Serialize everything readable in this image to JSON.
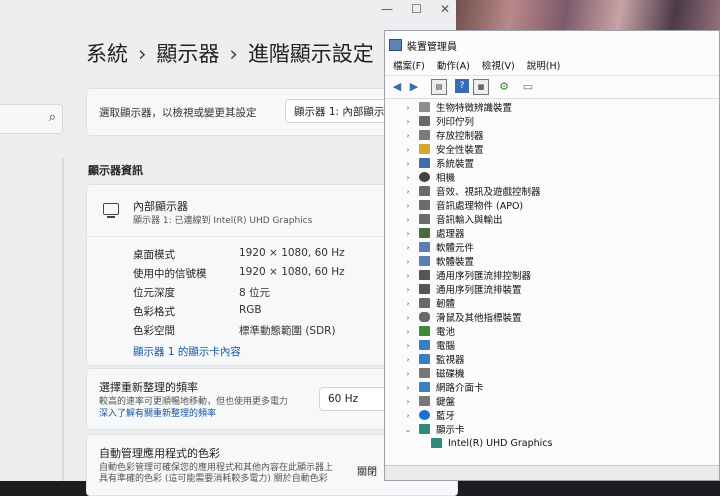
{
  "settings": {
    "breadcrumb": [
      "系統",
      "顯示器",
      "進階顯示設定"
    ],
    "select_label": "選取顯示器，以檢視或變更其設定",
    "select_value": "顯示器 1: 內部顯示器",
    "section_title": "顯示器資訊",
    "monitor_title": "內部顯示器",
    "monitor_subtitle": "顯示器 1: 已連線到 Intel(R) UHD Graphics",
    "info_rows": [
      {
        "label": "桌面模式",
        "value": "1920 × 1080, 60 Hz"
      },
      {
        "label": "使用中的信號模",
        "value": "1920 × 1080, 60 Hz"
      },
      {
        "label": "位元深度",
        "value": "8 位元"
      },
      {
        "label": "色彩格式",
        "value": "RGB"
      },
      {
        "label": "色彩空間",
        "value": "標準動態範圍 (SDR)"
      }
    ],
    "adapter_link": "顯示器 1 的顯示卡內容",
    "refresh_title": "選擇重新整理的頻率",
    "refresh_desc": "較高的速率可更順暢地移動，但也使用更多電力",
    "refresh_link": "深入了解有關重新整理的頻率",
    "refresh_value": "60 Hz",
    "color_title": "自動管理應用程式的色彩",
    "color_desc1": "自動色彩管理可確保您的應用程式和其他內容在此顯示器上",
    "color_desc2": "具有準確的色彩 (這可能需要消耗較多電力) 關於自動色彩",
    "color_toggle_label": "關閉"
  },
  "devmgr": {
    "title": "裝置管理員",
    "menu": [
      "檔案(F)",
      "動作(A)",
      "檢視(V)",
      "說明(H)"
    ],
    "tree": [
      {
        "label": "生物特徵辨識裝置",
        "color": "#8d8d8d",
        "expanded": false
      },
      {
        "label": "列印佇列",
        "color": "#6a6a6a",
        "expanded": false
      },
      {
        "label": "存放控制器",
        "color": "#7a7a7a",
        "expanded": false
      },
      {
        "label": "安全性裝置",
        "color": "#d4a82a",
        "expanded": false
      },
      {
        "label": "系統裝置",
        "color": "#3f6ea8",
        "expanded": false
      },
      {
        "label": "相機",
        "color": "#444444",
        "expanded": false
      },
      {
        "label": "音效、視訊及遊戲控制器",
        "color": "#6b6b6b",
        "expanded": false
      },
      {
        "label": "音訊處理物件 (APO)",
        "color": "#6b6b6b",
        "expanded": false
      },
      {
        "label": "音訊輸入與輸出",
        "color": "#6b6b6b",
        "expanded": false
      },
      {
        "label": "處理器",
        "color": "#4d6b3a",
        "expanded": false
      },
      {
        "label": "軟體元件",
        "color": "#5b7fb3",
        "expanded": false
      },
      {
        "label": "軟體裝置",
        "color": "#5b7fb3",
        "expanded": false
      },
      {
        "label": "通用序列匯流排控制器",
        "color": "#555555",
        "expanded": false
      },
      {
        "label": "通用序列匯流排裝置",
        "color": "#555555",
        "expanded": false
      },
      {
        "label": "韌體",
        "color": "#6a6a6a",
        "expanded": false
      },
      {
        "label": "滑鼠及其他指標裝置",
        "color": "#6a6a6a",
        "expanded": false
      },
      {
        "label": "電池",
        "color": "#3b8b3b",
        "expanded": false
      },
      {
        "label": "電腦",
        "color": "#3a7fbf",
        "expanded": false
      },
      {
        "label": "監視器",
        "color": "#3a7fbf",
        "expanded": false
      },
      {
        "label": "磁碟機",
        "color": "#777777",
        "expanded": false
      },
      {
        "label": "網路介面卡",
        "color": "#3a7fbf",
        "expanded": false
      },
      {
        "label": "鍵盤",
        "color": "#777777",
        "expanded": false
      },
      {
        "label": "藍牙",
        "color": "#1f6fd1",
        "expanded": false
      },
      {
        "label": "顯示卡",
        "color": "#2f8a7c",
        "expanded": true
      }
    ],
    "child": {
      "label": "Intel(R) UHD Graphics",
      "color": "#2f8a7c"
    }
  }
}
